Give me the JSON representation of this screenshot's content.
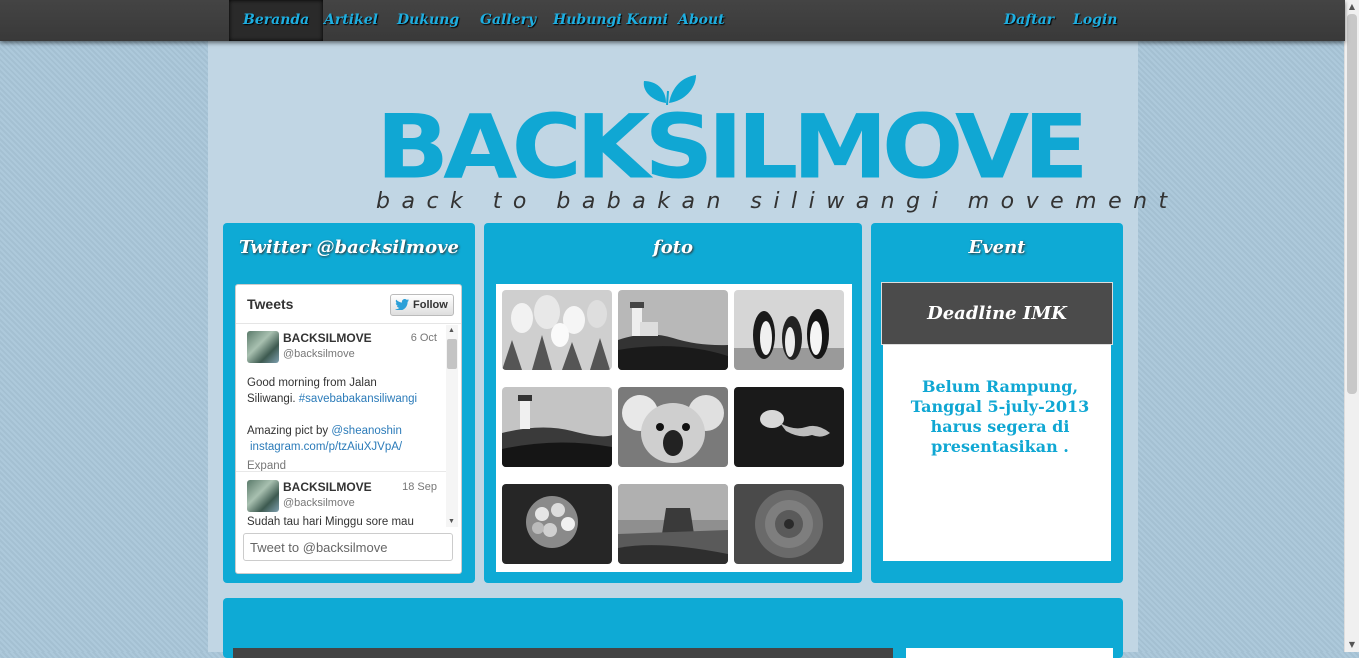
{
  "nav": {
    "items": [
      {
        "label": "Beranda",
        "active": true
      },
      {
        "label": "Artikel"
      },
      {
        "label": "Dukung"
      },
      {
        "label": "Gallery"
      },
      {
        "label": "Hubungi Kami"
      },
      {
        "label": "About"
      }
    ],
    "right": [
      {
        "label": "Daftar"
      },
      {
        "label": "Login"
      }
    ]
  },
  "logo": {
    "name": "BACKSILMOVE",
    "tagline": "back to babakan siliwangi movement"
  },
  "colors": {
    "accent": "#0eaad5",
    "navbar": "#3d3d3d",
    "nav_text": "#1eaee0",
    "page_bg": "#a9c6d9"
  },
  "twitter": {
    "title": "Twitter @backsilmove",
    "widget_title": "Tweets",
    "follow_label": "Follow",
    "tweets": [
      {
        "name": "BACKSILMOVE",
        "handle": "@backsilmove",
        "date": "6 Oct",
        "text_1": "Good morning from Jalan",
        "text_2a": "Siliwangi. ",
        "hashtag": "#savebabakansiliwangi",
        "text_3": "Amazing pict by ",
        "mention": "@sheanoshin",
        "link": "instagram.com/p/tzAiuXJVpA/",
        "expand": "Expand"
      },
      {
        "name": "BACKSILMOVE",
        "handle": "@backsilmove",
        "date": "18 Sep",
        "text_1": "Sudah tau hari Minggu sore mau"
      }
    ],
    "input_placeholder": "Tweet to @backsilmove"
  },
  "foto": {
    "title": "foto",
    "images": [
      "tulips",
      "lighthouse",
      "penguins",
      "lighthouse-2",
      "koala",
      "jellyfish",
      "hydrangeas",
      "desert",
      "chrysanthemum"
    ]
  },
  "event": {
    "title": "Event",
    "item_title": "Deadline IMK",
    "item_text": "Belum Rampung, Tanggal 5-july-2013 harus segera di presentasikan ."
  }
}
